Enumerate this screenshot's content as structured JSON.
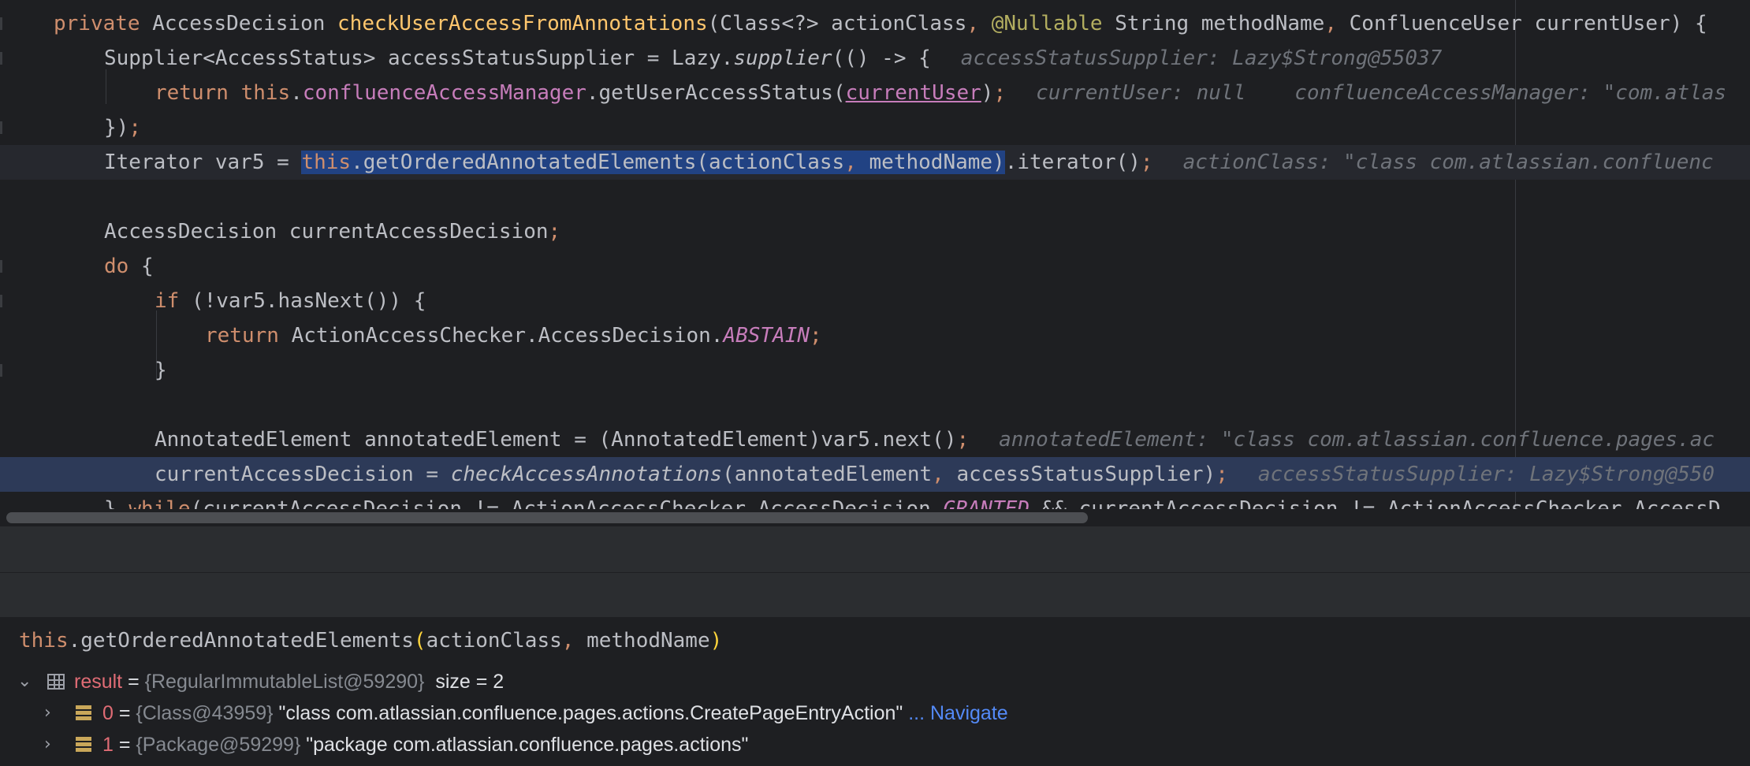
{
  "editor": {
    "lines": [
      {
        "kind": "code",
        "text": "private AccessDecision checkUserAccessFromAnnotations(Class<?> actionClass, @Nullable String methodName, ConfluenceUser currentUser) {"
      },
      {
        "kind": "code",
        "text": "Supplier<AccessStatus> accessStatusSupplier = Lazy.supplier(() -> {",
        "inlay": "accessStatusSupplier: Lazy$Strong@55037"
      },
      {
        "kind": "code",
        "text": "return this.confluenceAccessManager.getUserAccessStatus(currentUser);",
        "inlay": "currentUser: null",
        "inlay2": "confluenceAccessManager: \"com.atlas"
      },
      {
        "kind": "code",
        "text": "});"
      },
      {
        "kind": "code",
        "text": "Iterator var5 = this.getOrderedAnnotatedElements(actionClass, methodName).iterator();",
        "inlay": "actionClass: \"class com.atlassian.confluenc"
      },
      {
        "kind": "code",
        "text": ""
      },
      {
        "kind": "code",
        "text": "AccessDecision currentAccessDecision;"
      },
      {
        "kind": "code",
        "text": "do {"
      },
      {
        "kind": "code",
        "text": "if (!var5.hasNext()) {"
      },
      {
        "kind": "code",
        "text": "return ActionAccessChecker.AccessDecision.ABSTAIN;"
      },
      {
        "kind": "code",
        "text": "}"
      },
      {
        "kind": "code",
        "text": ""
      },
      {
        "kind": "code",
        "text": "AnnotatedElement annotatedElement = (AnnotatedElement)var5.next();",
        "inlay": "annotatedElement: \"class com.atlassian.confluence.pages.ac"
      },
      {
        "kind": "code",
        "text": "currentAccessDecision = checkAccessAnnotations(annotatedElement, accessStatusSupplier);",
        "inlay": "accessStatusSupplier: Lazy$Strong@550"
      },
      {
        "kind": "code",
        "text": "} while(currentAccessDecision != ActionAccessChecker.AccessDecision.GRANTED && currentAccessDecision != ActionAccessChecker.AccessD"
      }
    ]
  },
  "debugger": {
    "expression": "this.getOrderedAnnotatedElements(actionClass, methodName)",
    "result": {
      "name": "result",
      "eq": " = ",
      "type": "{RegularImmutableList@59290}",
      "size": "size = 2"
    },
    "children": [
      {
        "index": "0",
        "type": "{Class@43959}",
        "value": "\"class com.atlassian.confluence.pages.actions.CreatePageEntryAction\"",
        "link": "... Navigate"
      },
      {
        "index": "1",
        "type": "{Package@59299}",
        "value": "\"package com.atlassian.confluence.pages.actions\"",
        "link": ""
      }
    ]
  },
  "icons": [
    "chevron-down-icon",
    "chevron-right-icon",
    "table-icon",
    "list-icon"
  ],
  "colors": {
    "editor_bg": "#1e1f22",
    "keyword": "#cf8e6d",
    "selection": "#214283",
    "exec_line": "#2d3a58",
    "error_name": "#e06c75",
    "link": "#548af7"
  }
}
